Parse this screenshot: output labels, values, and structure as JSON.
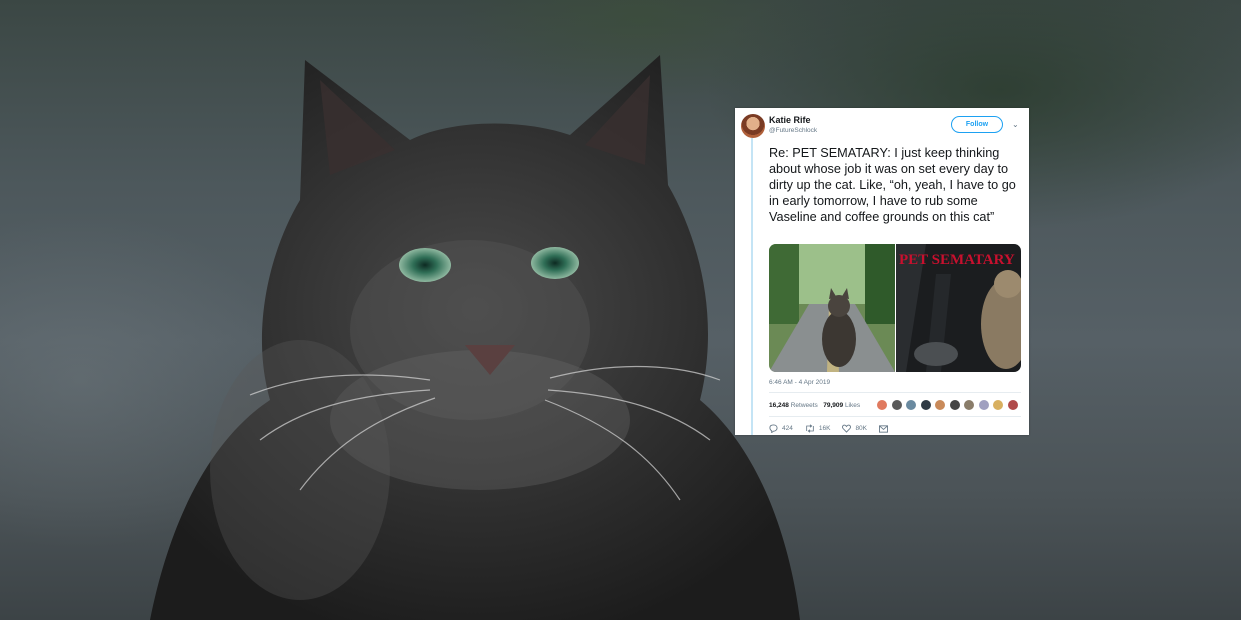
{
  "tweet": {
    "display_name": "Katie Rife",
    "handle": "@FutureSchlock",
    "follow_label": "Follow",
    "text": "Re: PET SEMATARY: I just keep thinking about whose job it was on set every day to dirty up the cat. Like, “oh, yeah, I have to go in early tomorrow, I have to rub some Vaseline and coffee grounds on this cat”",
    "media_title": "PET SEMATARY",
    "timestamp": "6:46 AM - 4 Apr 2019",
    "retweets_count": "16,248",
    "retweets_label": "Retweets",
    "likes_count": "79,909",
    "likes_label": "Likes",
    "actions": {
      "reply_count": "424",
      "retweet_count": "16K",
      "like_count": "80K"
    }
  },
  "colors": {
    "accent": "#1da1f2",
    "text": "#14171a",
    "muted": "#657786",
    "media_title_red": "#c8102e"
  }
}
